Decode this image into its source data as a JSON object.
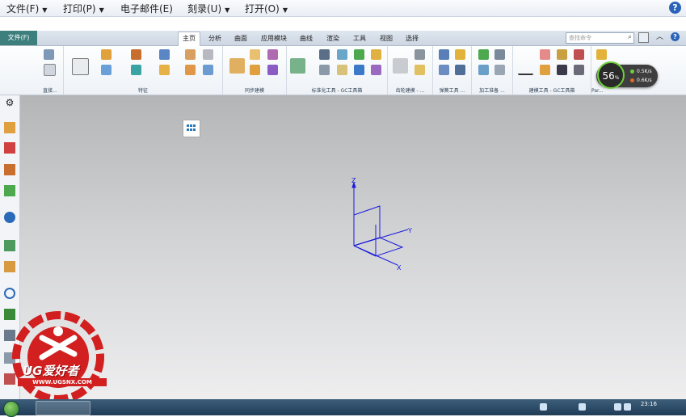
{
  "menubar": {
    "items": [
      {
        "label": "文件(F)"
      },
      {
        "label": "打印(P)"
      },
      {
        "label": "电子邮件(E)"
      },
      {
        "label": "刻录(U)"
      },
      {
        "label": "打开(O)"
      }
    ],
    "help_icon": "help-icon",
    "help_glyph": "?"
  },
  "ribbon_tabs": {
    "file_tab": "文件(F)",
    "tabs": [
      "主页",
      "分析",
      "曲面",
      "应用模块",
      "曲线",
      "渲染",
      "工具",
      "视图",
      "选择"
    ],
    "active_tab": "主页",
    "search_placeholder": "查找命令"
  },
  "ribbon_groups": [
    {
      "label": "直接..."
    },
    {
      "label": "特征"
    },
    {
      "label": "同步建模"
    },
    {
      "label": "标准化工具 - GC工具箱"
    },
    {
      "label": "齿轮建模 - ..."
    },
    {
      "label": "弹簧工具 ..."
    },
    {
      "label": "加工准备 ..."
    },
    {
      "label": "建模工具 - GC工具箱"
    },
    {
      "label": "Par..."
    }
  ],
  "network_meter": {
    "percent": "56",
    "percent_unit": "%",
    "upload": "0.5K/s",
    "download": "0.6K/s",
    "up_color": "#6fcf3a",
    "down_color": "#e06a2a"
  },
  "triad": {
    "x_label": "X",
    "y_label": "Y",
    "z_label": "Z",
    "color": "#1a1adc"
  },
  "taskbar": {
    "clock": "23:16"
  },
  "watermark": {
    "brand": "UG爱好者",
    "url": "WWW.UGSNX.COM",
    "color": "#d21f1f"
  }
}
